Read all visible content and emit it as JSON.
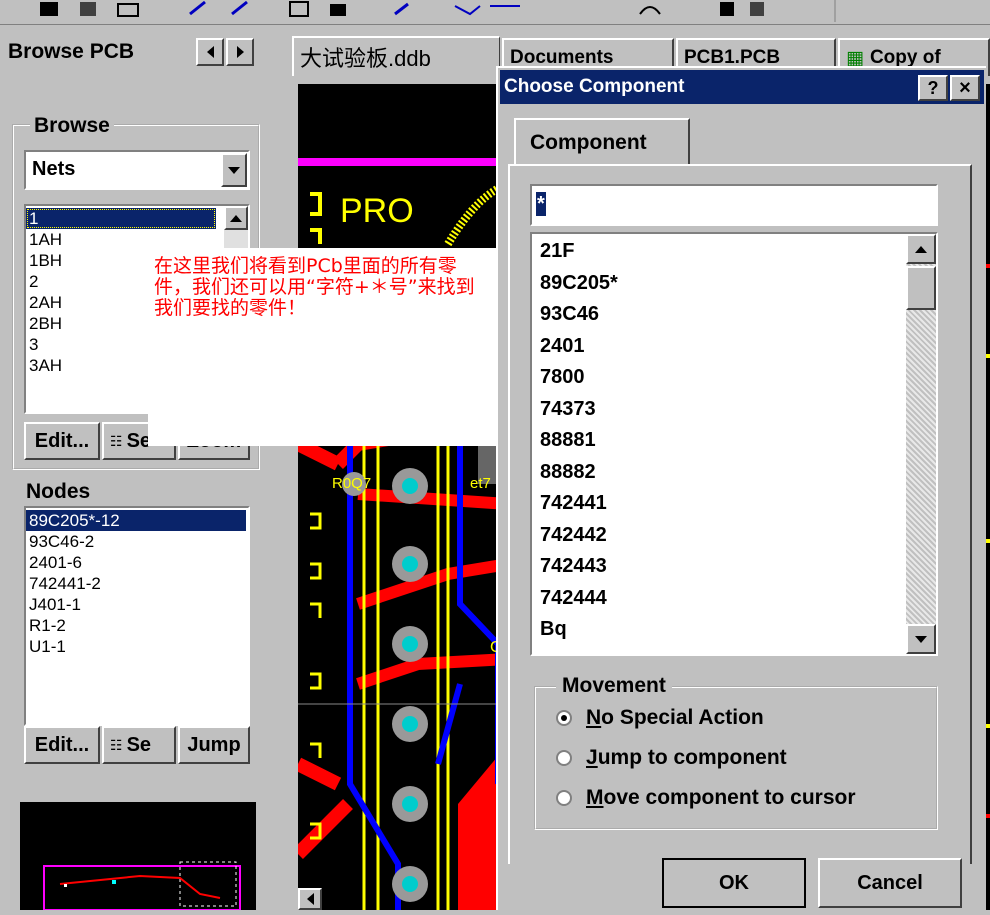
{
  "toolbar": {
    "icons": [
      "layout-icon",
      "grid-icon",
      "print-icon",
      "route-icon",
      "route2-icon",
      "rect-icon",
      "zoom-icon",
      "wire-icon",
      "pad-icon",
      "arc-icon",
      "hand-icon"
    ]
  },
  "left_panel": {
    "title": "Browse PCB",
    "browse_group": "Browse",
    "browse_select": "Nets",
    "nets": [
      "1",
      "1AH",
      "1BH",
      "2",
      "2AH",
      "2BH",
      "3",
      "3AH"
    ],
    "nets_selected_index": 0,
    "buttons_top": {
      "edit": "Edit...",
      "select": "Se",
      "zoom": "Zoom"
    },
    "nodes_label": "Nodes",
    "nodes": [
      "89C205*-12",
      "93C46-2",
      "2401-6",
      "742441-2",
      "J401-1",
      "R1-2",
      "U1-1"
    ],
    "nodes_selected_index": 0,
    "buttons_bottom": {
      "edit": "Edit...",
      "select": "Se",
      "jump": "Jump"
    }
  },
  "tabs": [
    "大试验板.ddb",
    "Documents",
    "PCB1.PCB",
    "Copy of"
  ],
  "pcb_labels": {
    "pro": "PRO",
    "r0q": "R0Q7",
    "net": "et7",
    "g": "G"
  },
  "annotation": "在这里我们将看到PCb里面的所有零件，我们还可以用“字符+＊号”来找到我们要找的零件！",
  "dialog": {
    "title": "Choose Component",
    "help_btn": "?",
    "close_btn": "×",
    "tab_label": "Component",
    "search_value": "*",
    "components": [
      "21F",
      "89C205*",
      "93C46",
      "2401",
      "7800",
      "74373",
      "88881",
      "88882",
      "742441",
      "742442",
      "742443",
      "742444",
      "Bq"
    ],
    "movement_label": "Movement",
    "options": [
      {
        "label": "No Special Action",
        "underline": "N",
        "rest": "o Special Action",
        "selected": true
      },
      {
        "label": "Jump to component",
        "underline": "J",
        "rest": "ump to component",
        "selected": false
      },
      {
        "label": "Move component to cursor",
        "underline": "M",
        "rest": "ove component to cursor",
        "selected": false
      }
    ],
    "ok": "OK",
    "cancel": "Cancel"
  },
  "colors": {
    "titlebar": "#0a246a",
    "selection": "#0a246a",
    "annotation_text": "#ff0000",
    "pcb_bg": "#000000"
  }
}
